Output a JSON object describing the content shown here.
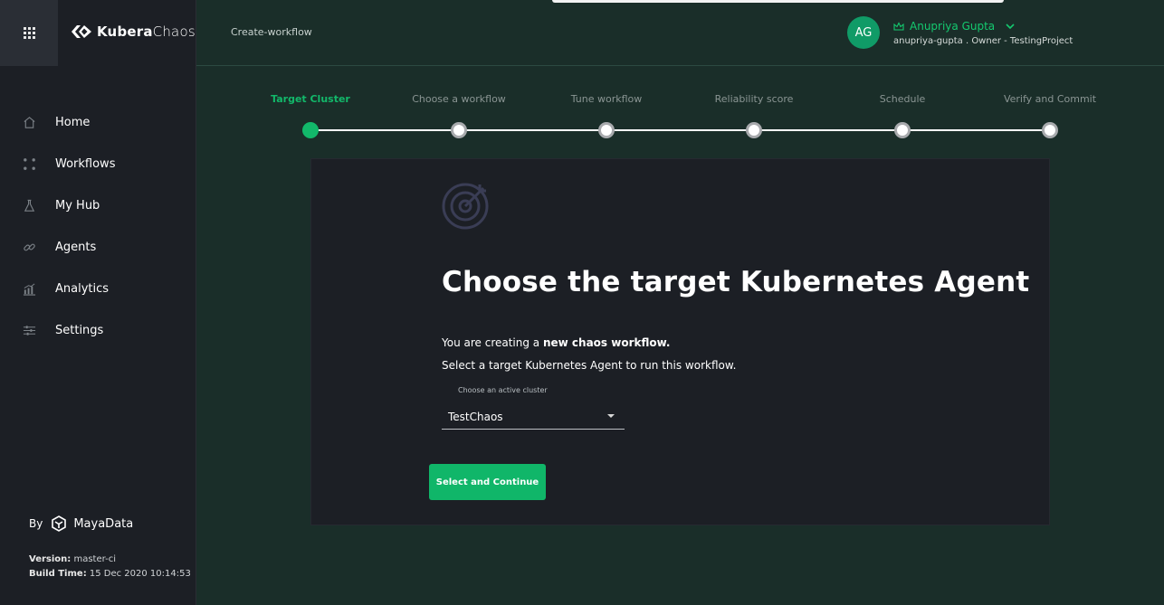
{
  "app": {
    "logo_bold": "Kubera",
    "logo_light": "Chaos",
    "breadcrumb": "Create-workflow"
  },
  "sidebar": {
    "items": [
      {
        "label": "Home",
        "icon": "home-icon"
      },
      {
        "label": "Workflows",
        "icon": "workflows-icon"
      },
      {
        "label": "My Hub",
        "icon": "flask-icon"
      },
      {
        "label": "Agents",
        "icon": "link-icon"
      },
      {
        "label": "Analytics",
        "icon": "analytics-icon"
      },
      {
        "label": "Settings",
        "icon": "sliders-icon"
      }
    ],
    "by_label": "By",
    "brand": "MayaData",
    "version_label": "Version:",
    "version_value": "master-ci",
    "build_label": "Build Time:",
    "build_value": "15 Dec 2020 10:14:53"
  },
  "user": {
    "initials": "AG",
    "name": "Anupriya Gupta",
    "details": "anupriya-gupta . Owner - TestingProject"
  },
  "stepper": {
    "steps": [
      {
        "label": "Target Cluster",
        "state": "active"
      },
      {
        "label": "Choose a workflow",
        "state": "pending"
      },
      {
        "label": "Tune workflow",
        "state": "pending"
      },
      {
        "label": "Reliability score",
        "state": "pending"
      },
      {
        "label": "Schedule",
        "state": "pending"
      },
      {
        "label": "Verify and Commit",
        "state": "pending"
      }
    ]
  },
  "main": {
    "title": "Choose the target Kubernetes Agent",
    "desc1_prefix": "You are creating a ",
    "desc1_bold": "new chaos workflow.",
    "desc2": "Select a target Kubernetes Agent to run this workflow.",
    "select_label": "Choose an active cluster",
    "select_value": "TestChaos",
    "cta_label": "Select and Continue"
  },
  "colors": {
    "accent": "#12b86a",
    "background": "#1a2e29",
    "sidebar": "#1c1f25",
    "card": "#1c1f25"
  }
}
